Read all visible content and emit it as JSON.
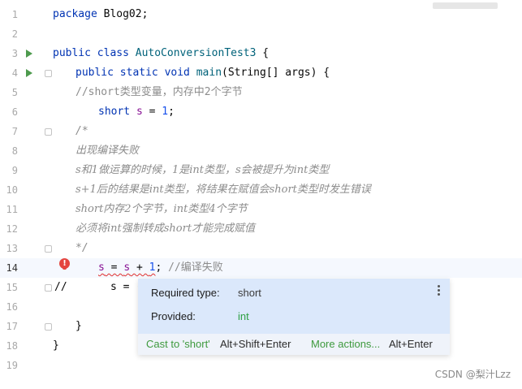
{
  "editor": {
    "lines": [
      {
        "n": "1"
      },
      {
        "n": "2"
      },
      {
        "n": "3"
      },
      {
        "n": "4"
      },
      {
        "n": "5"
      },
      {
        "n": "6"
      },
      {
        "n": "7"
      },
      {
        "n": "8"
      },
      {
        "n": "9"
      },
      {
        "n": "10"
      },
      {
        "n": "11"
      },
      {
        "n": "12"
      },
      {
        "n": "13"
      },
      {
        "n": "14"
      },
      {
        "n": "15"
      },
      {
        "n": "16"
      },
      {
        "n": "17"
      },
      {
        "n": "18"
      },
      {
        "n": "19"
      }
    ],
    "code": {
      "l1_kw": "package",
      "l1_rest": " Blog02;",
      "l3_kw": "public class",
      "l3_cls": "AutoConversionTest3",
      "l3_rest": " {",
      "l4_kw": "public static void",
      "l4_fn": "main",
      "l4_rest": "(String[] args) {",
      "l5_cm": "//short类型变量，内存中2个字节",
      "l6_kw": "short",
      "l6_var": "s",
      "l6_eq": " = ",
      "l6_num": "1",
      "l6_end": ";",
      "l7_cm": "/*",
      "l8_cm": "出现编译失败",
      "l9_cm": "s和1做运算的时候，1是int类型，s会被提升为int类型",
      "l10_cm": "s+1后的结果是int类型，将结果在赋值会short类型时发生错误",
      "l11_cm": "short内存2个字节，int类型4个字节",
      "l12_cm": "必须将int强制转成short才能完成赋值",
      "l13_cm": "*/",
      "l14_a": "s",
      "l14_b": " = ",
      "l14_c": "s",
      "l14_d": " + ",
      "l14_e": "1",
      "l14_f": "; ",
      "l14_cm": "//编译失败",
      "l15_prefix": "//",
      "l15_code": "s = (",
      "l17_brace": "}",
      "l18_brace": "}"
    }
  },
  "popup": {
    "required_label": "Required type:",
    "required_value": "short",
    "provided_label": "Provided:",
    "provided_value": "int",
    "action1_label": "Cast to 'short'",
    "action1_shortcut": "Alt+Shift+Enter",
    "action2_label": "More actions...",
    "action2_shortcut": "Alt+Enter",
    "provided_color": "#2ea043"
  },
  "icons": {
    "run": "run-arrow-icon",
    "fold": "fold-marker-icon",
    "error": "error-bulb-icon",
    "more": "more-vertical-icon"
  },
  "watermark": "CSDN @梨汁Lzz"
}
